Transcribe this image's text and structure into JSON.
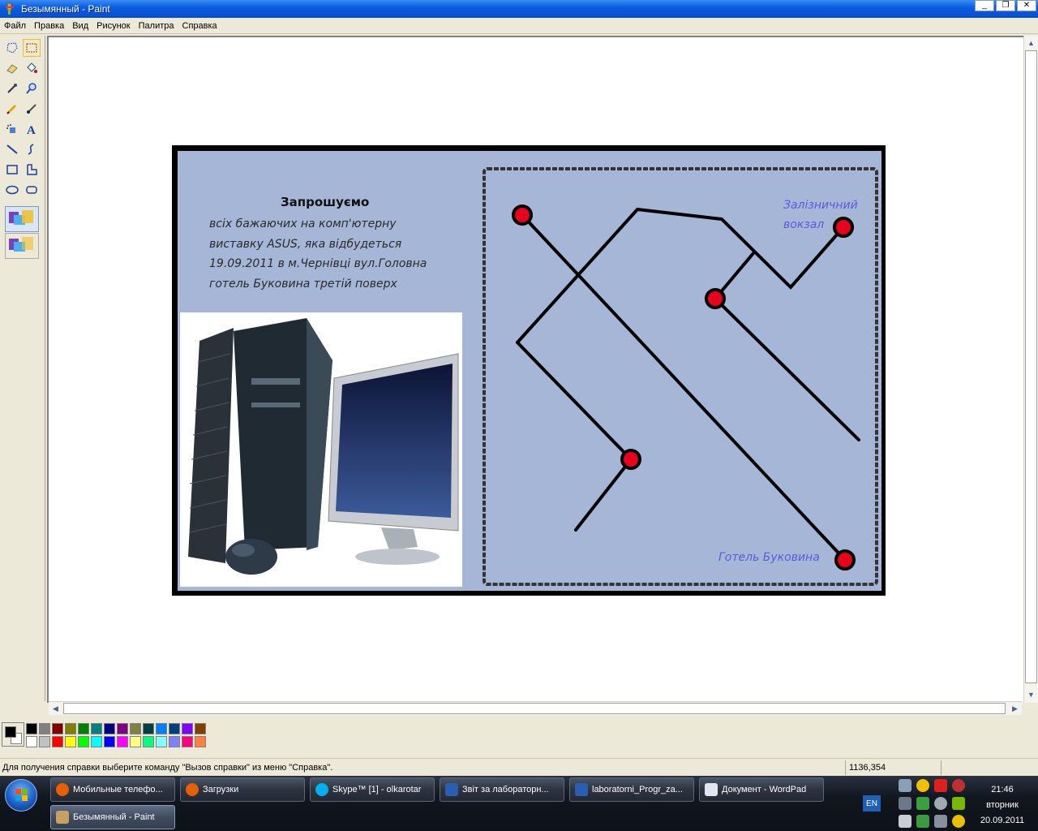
{
  "window": {
    "title": "Безымянный - Paint",
    "controls": {
      "minimize": "_",
      "maximize": "❐",
      "close": "✕"
    }
  },
  "menu": [
    "Файл",
    "Правка",
    "Вид",
    "Рисунок",
    "Палитра",
    "Справка"
  ],
  "tools": [
    {
      "name": "free-select",
      "icon": "free-form-select-icon"
    },
    {
      "name": "rect-select",
      "icon": "rectangle-select-icon"
    },
    {
      "name": "eraser",
      "icon": "eraser-icon"
    },
    {
      "name": "fill",
      "icon": "fill-bucket-icon"
    },
    {
      "name": "pick-color",
      "icon": "eyedropper-icon"
    },
    {
      "name": "magnifier",
      "icon": "magnifier-icon"
    },
    {
      "name": "pencil",
      "icon": "pencil-icon"
    },
    {
      "name": "brush",
      "icon": "brush-icon"
    },
    {
      "name": "airbrush",
      "icon": "airbrush-icon"
    },
    {
      "name": "text",
      "icon": "text-icon",
      "label": "A"
    },
    {
      "name": "line",
      "icon": "line-icon"
    },
    {
      "name": "curve",
      "icon": "curve-icon"
    },
    {
      "name": "rectangle",
      "icon": "rectangle-icon"
    },
    {
      "name": "polygon",
      "icon": "polygon-icon"
    },
    {
      "name": "ellipse",
      "icon": "ellipse-icon"
    },
    {
      "name": "rounded-rect",
      "icon": "rounded-rectangle-icon"
    }
  ],
  "picture": {
    "heading": "Запрошуємо",
    "lines": [
      "всіх бажаючих на комп'ютерну",
      "виставку ASUS, яка відбудеться",
      "19.09.2011 в м.Чернівці вул.Головна",
      "готель Буковина третій поверх"
    ],
    "map_label_station_1": "Залізничний",
    "map_label_station_2": "вокзал",
    "map_label_hotel": "Готель Буковина"
  },
  "palette": {
    "foreground": "#000000",
    "background": "#ffffff",
    "row1": [
      "#000000",
      "#808080",
      "#800000",
      "#808000",
      "#008000",
      "#008080",
      "#000080",
      "#800080",
      "#808040",
      "#004040",
      "#0080ff",
      "#004080",
      "#8000ff",
      "#804000"
    ],
    "row2": [
      "#ffffff",
      "#c0c0c0",
      "#ff0000",
      "#ffff00",
      "#00ff00",
      "#00ffff",
      "#0000ff",
      "#ff00ff",
      "#ffff80",
      "#00ff80",
      "#80ffff",
      "#8080ff",
      "#ff0080",
      "#ff8040"
    ]
  },
  "status": {
    "message": "Для получения справки выберите команду \"Вызов справки\" из меню \"Справка\".",
    "coords": "1136,354"
  },
  "taskbar": {
    "buttons": [
      {
        "label": "Мобильные телефо...",
        "icon": "firefox-icon",
        "color": "#e66000"
      },
      {
        "label": "Загрузки",
        "icon": "firefox-icon",
        "color": "#e66000"
      },
      {
        "label": "Skype™ [1] - olkarotar",
        "icon": "skype-icon",
        "color": "#00aff0"
      },
      {
        "label": "Звіт  за лабораторн...",
        "icon": "word-icon",
        "color": "#2b5eb3"
      },
      {
        "label": "laboratorni_Progr_za...",
        "icon": "word-icon",
        "color": "#2b5eb3"
      },
      {
        "label": "Документ - WordPad",
        "icon": "wordpad-icon",
        "color": "#dfe6f0"
      }
    ],
    "active_button": {
      "label": "Безымянный - Paint",
      "icon": "paint-icon",
      "color": "#c8a060"
    },
    "language": "EN",
    "clock": {
      "time": "21:46",
      "day": "вторник",
      "date": "20.09.2011"
    }
  }
}
